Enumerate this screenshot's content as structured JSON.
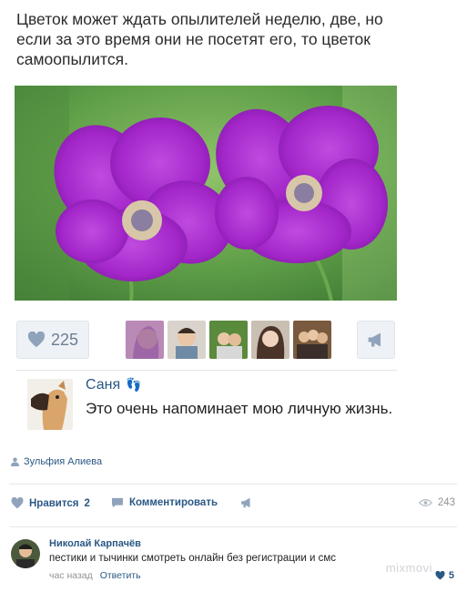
{
  "post": {
    "text": "Цветок может ждать опылителей неделю, две, но если за это время они не посетят его, то цветок самоопылится."
  },
  "embedded": {
    "likes_count": "225",
    "comment": {
      "author": "Саня",
      "text": "Это очень напоминает мою личную жизнь."
    }
  },
  "post_author": "Зульфия Алиева",
  "actions": {
    "like_label": "Нравится",
    "like_count": "2",
    "comment_label": "Комментировать",
    "views_count": "243"
  },
  "reply": {
    "author": "Николай Карпачёв",
    "text": "пестики и тычинки смотреть онлайн без регистрации и смс",
    "time": "час назад",
    "reply_label": "Ответить",
    "likes": "5"
  },
  "watermark": "mixmovi",
  "colors": {
    "link": "#2a5885",
    "muted": "#939393",
    "petal": "#a326c9"
  },
  "icons": [
    "heart-icon",
    "megaphone-icon",
    "person-icon",
    "comment-icon",
    "eye-icon",
    "footprints-icon"
  ]
}
